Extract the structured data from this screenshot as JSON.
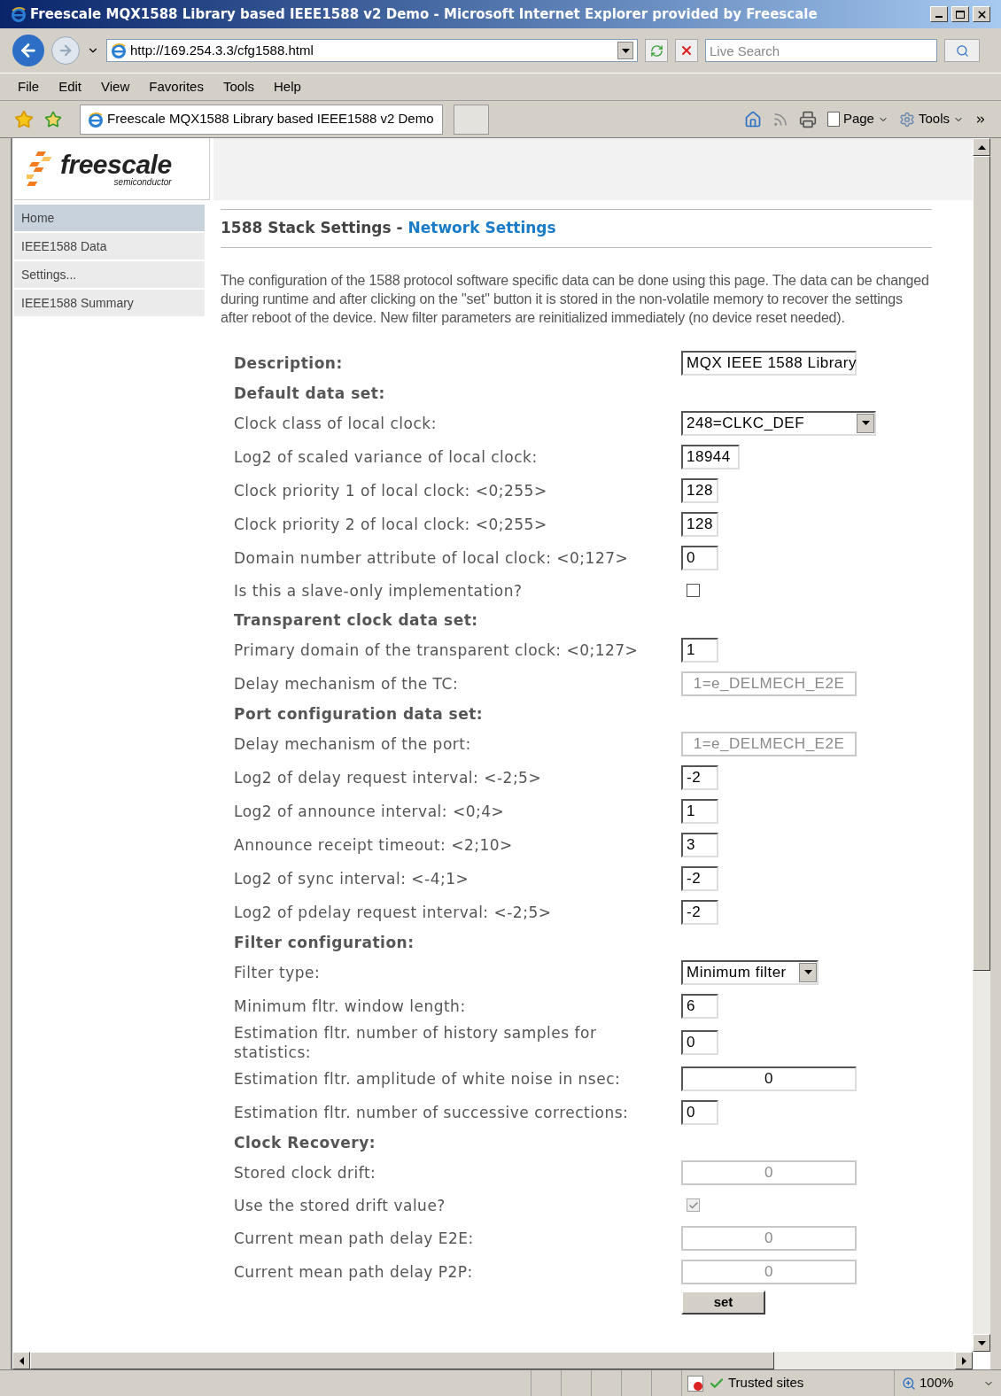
{
  "window": {
    "title": "Freescale MQX1588 Library based IEEE1588 v2 Demo - Microsoft Internet Explorer provided by Freescale"
  },
  "address_bar": {
    "url": "http://169.254.3.3/cfg1588.html",
    "search_placeholder": "Live Search"
  },
  "menu": [
    "File",
    "Edit",
    "View",
    "Favorites",
    "Tools",
    "Help"
  ],
  "tab": {
    "title": "Freescale MQX1588 Library based IEEE1588 v2 Demo"
  },
  "command_bar": [
    "Page",
    "Tools"
  ],
  "logo": {
    "name": "freescale",
    "tagline": "semiconductor"
  },
  "sidebar": {
    "items": [
      {
        "label": "Home",
        "selected": true
      },
      {
        "label": "IEEE1588 Data",
        "selected": false
      },
      {
        "label": "Settings...",
        "selected": false
      },
      {
        "label": "IEEE1588 Summary",
        "selected": false
      }
    ]
  },
  "heading": {
    "prefix": "1588 Stack Settings - ",
    "highlight": "Network Settings"
  },
  "intro": "The configuration of the 1588 protocol software specific data can be done using this page. The data can be changed during runtime and after clicking on the \"set\" button it is stored in the non-volatile memory to recover the settings after reboot of the device. New filter parameters are reinitialized immediately (no device reset needed).",
  "form": [
    {
      "kind": "text",
      "label": "Description:",
      "value": "MQX IEEE 1588 Library",
      "disabled": false
    },
    {
      "kind": "section",
      "label": "Default data set:"
    },
    {
      "kind": "wide-select",
      "label": "Clock class of local clock:",
      "value": "248=CLKC_DEF"
    },
    {
      "kind": "medium",
      "label": "Log2 of scaled variance of local clock:",
      "value": "18944",
      "disabled": false
    },
    {
      "kind": "short",
      "label": "Clock priority 1 of local clock: <0;255>",
      "value": "128",
      "disabled": false
    },
    {
      "kind": "short",
      "label": "Clock priority 2 of local clock: <0;255>",
      "value": "128",
      "disabled": false
    },
    {
      "kind": "short",
      "label": "Domain number attribute of local clock: <0;127>",
      "value": "0",
      "disabled": false
    },
    {
      "kind": "checkbox",
      "label": "Is this a slave-only implementation?",
      "checked": false,
      "disabled": false
    },
    {
      "kind": "section",
      "label": "Transparent clock data set:"
    },
    {
      "kind": "short",
      "label": "Primary domain of the transparent clock: <0;127>",
      "value": "1",
      "disabled": false
    },
    {
      "kind": "wide",
      "label": "Delay mechanism of the TC:",
      "value": "1=e_DELMECH_E2E",
      "disabled": true
    },
    {
      "kind": "section",
      "label": "Port configuration data set:"
    },
    {
      "kind": "wide",
      "label": "Delay mechanism of the port:",
      "value": "1=e_DELMECH_E2E",
      "disabled": true
    },
    {
      "kind": "short",
      "label": "Log2 of delay request interval: <-2;5>",
      "value": "-2",
      "disabled": false
    },
    {
      "kind": "short",
      "label": "Log2 of announce interval: <0;4>",
      "value": "1",
      "disabled": false
    },
    {
      "kind": "short",
      "label": "Announce receipt timeout: <2;10>",
      "value": "3",
      "disabled": false
    },
    {
      "kind": "short",
      "label": "Log2 of sync interval: <-4;1>",
      "value": "-2",
      "disabled": false
    },
    {
      "kind": "short",
      "label": "Log2 of pdelay request interval: <-2;5>",
      "value": "-2",
      "disabled": false
    },
    {
      "kind": "section",
      "label": "Filter configuration:"
    },
    {
      "kind": "medium-select",
      "label": "Filter type:",
      "value": "Minimum filter"
    },
    {
      "kind": "short",
      "label": "Minimum fltr. window length:",
      "value": "6",
      "disabled": false
    },
    {
      "kind": "short",
      "label": "Estimation fltr. number of history samples for statistics:",
      "value": "0",
      "disabled": false
    },
    {
      "kind": "wide",
      "label": "Estimation fltr. amplitude of white noise in nsec:",
      "value": "0",
      "disabled": false
    },
    {
      "kind": "short",
      "label": "Estimation fltr. number of successive corrections:",
      "value": "0",
      "disabled": false
    },
    {
      "kind": "section",
      "label": "Clock Recovery:"
    },
    {
      "kind": "wide",
      "label": "Stored clock drift:",
      "value": "0",
      "disabled": true
    },
    {
      "kind": "checkbox",
      "label": "Use the stored drift value?",
      "checked": true,
      "disabled": true
    },
    {
      "kind": "wide",
      "label": "Current mean path delay E2E:",
      "value": "0",
      "disabled": true
    },
    {
      "kind": "wide",
      "label": "Current mean path delay P2P:",
      "value": "0",
      "disabled": true
    }
  ],
  "submit": "set",
  "status_bar": {
    "zone": "Trusted sites",
    "zoom": "100%"
  }
}
